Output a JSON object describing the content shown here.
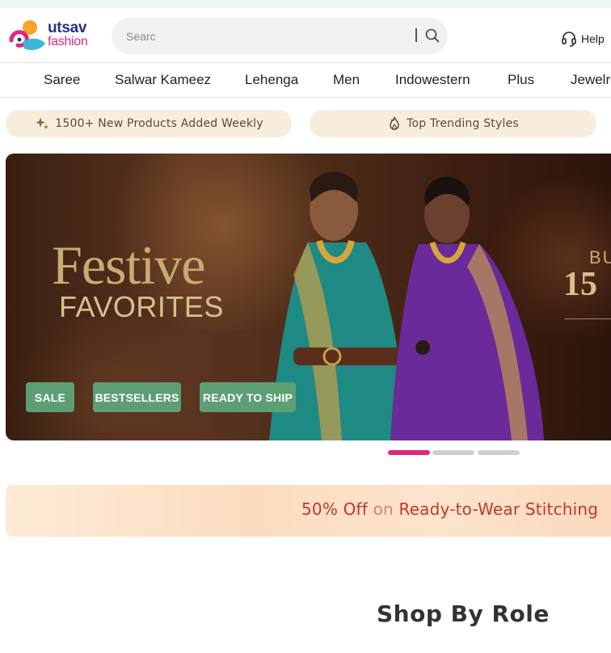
{
  "brand": {
    "logo_line1": "utsav",
    "logo_line2": "fashion"
  },
  "search": {
    "placeholder": "Searc"
  },
  "header": {
    "help_label": "Help"
  },
  "nav": {
    "items": [
      "Saree",
      "Salwar Kameez",
      "Lehenga",
      "Men",
      "Indowestern",
      "Plus",
      "Jewelr"
    ]
  },
  "promos": {
    "weekly": "1500+ New Products Added Weekly",
    "trending": "Top Trending Styles"
  },
  "hero": {
    "title": "Festive",
    "subtitle": "FAVORITES",
    "right_line1": "BU",
    "right_line2": "15",
    "buttons": [
      "SALE",
      "BESTSELLERS",
      "READY TO SHIP"
    ]
  },
  "carousel": {
    "slides": 3,
    "active": 0
  },
  "offer": {
    "part1": "50% Off",
    "part2": "on",
    "part3": "Ready-to-Wear Stitching"
  },
  "sections": {
    "shop_by_role": "Shop By Role"
  },
  "colors": {
    "brand_pink": "#e0287d",
    "brand_navy": "#2c2f86",
    "button_green": "#5e9e74",
    "promo_bg": "#f8ecdc"
  }
}
